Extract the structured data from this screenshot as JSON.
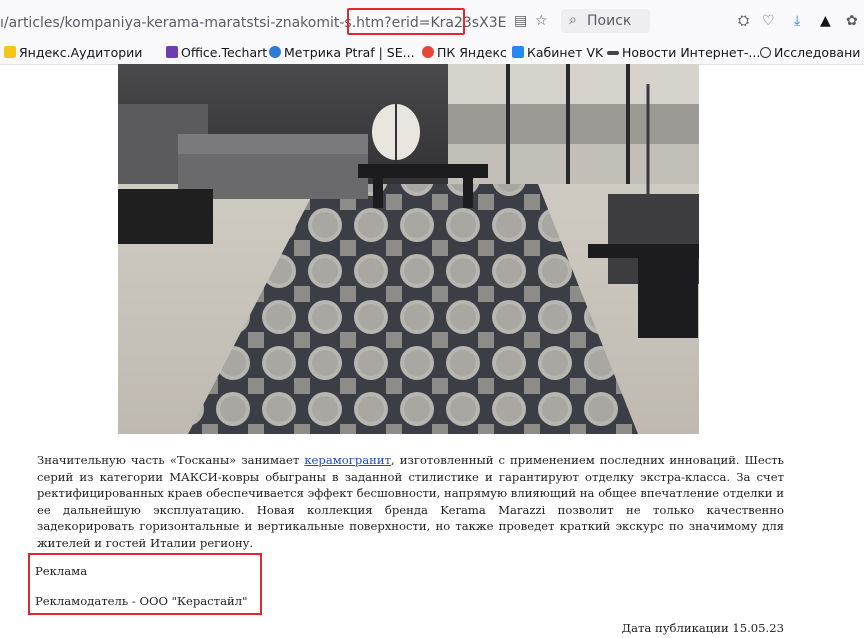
{
  "browser": {
    "url_main": "ı/articles/kompaniya-kerama-maratstsi-znakomit-s.htm",
    "url_query": "?erid=Kra23sX3E",
    "search_label": "Поиск"
  },
  "bookmarks": [
    {
      "label": "Яндекс.Аудитории",
      "icon": "yandex-audience-icon",
      "color": "#f5c518"
    },
    {
      "label": "Office.Techart",
      "icon": "office-techart-icon",
      "color": "#6b3fb0"
    },
    {
      "label": "Метрика Ptraf | SE...",
      "icon": "metrika-icon",
      "color": "#2f7bd9"
    },
    {
      "label": "ПК Яндекс",
      "icon": "yandex-pc-icon",
      "color": "#e8443a"
    },
    {
      "label": "Кабинет VK",
      "icon": "vk-icon",
      "color": "#2787f5"
    },
    {
      "label": "Новости Интернет-...",
      "icon": "news-icon",
      "color": "#444444"
    },
    {
      "label": "Исследовани",
      "icon": "research-icon",
      "color": "#333333"
    }
  ],
  "article": {
    "text_before_link": "Значительную часть «Тосканы» занимает ",
    "link_text": "керамогранит",
    "text_after_link": ", изготовленный с применением последних инноваций. Шесть серий из категории МАКСИ-ковры обыграны в заданной стилистике и гарантируют отделку экстра-класса. За счет ректифицированных краев обеспечивается эффект бесшовности, напрямую влияющий на общее впечатление отделки и ее дальнейшую эксплуатацию. Новая коллекция бренда Kerama Marazzi позволит не только качественно задекорировать горизонтальные и вертикальные поверхности, но также проведет краткий экскурс по значимому для жителей и гостей Италии региону."
  },
  "ad": {
    "label": "Реклама",
    "advertiser": "Рекламодатель - ООО \"Керастайл\""
  },
  "publication": {
    "date_text": "Дата публикации 15.05.23"
  },
  "colors": {
    "highlight": "#e0282e",
    "link": "#1a4fb8"
  }
}
